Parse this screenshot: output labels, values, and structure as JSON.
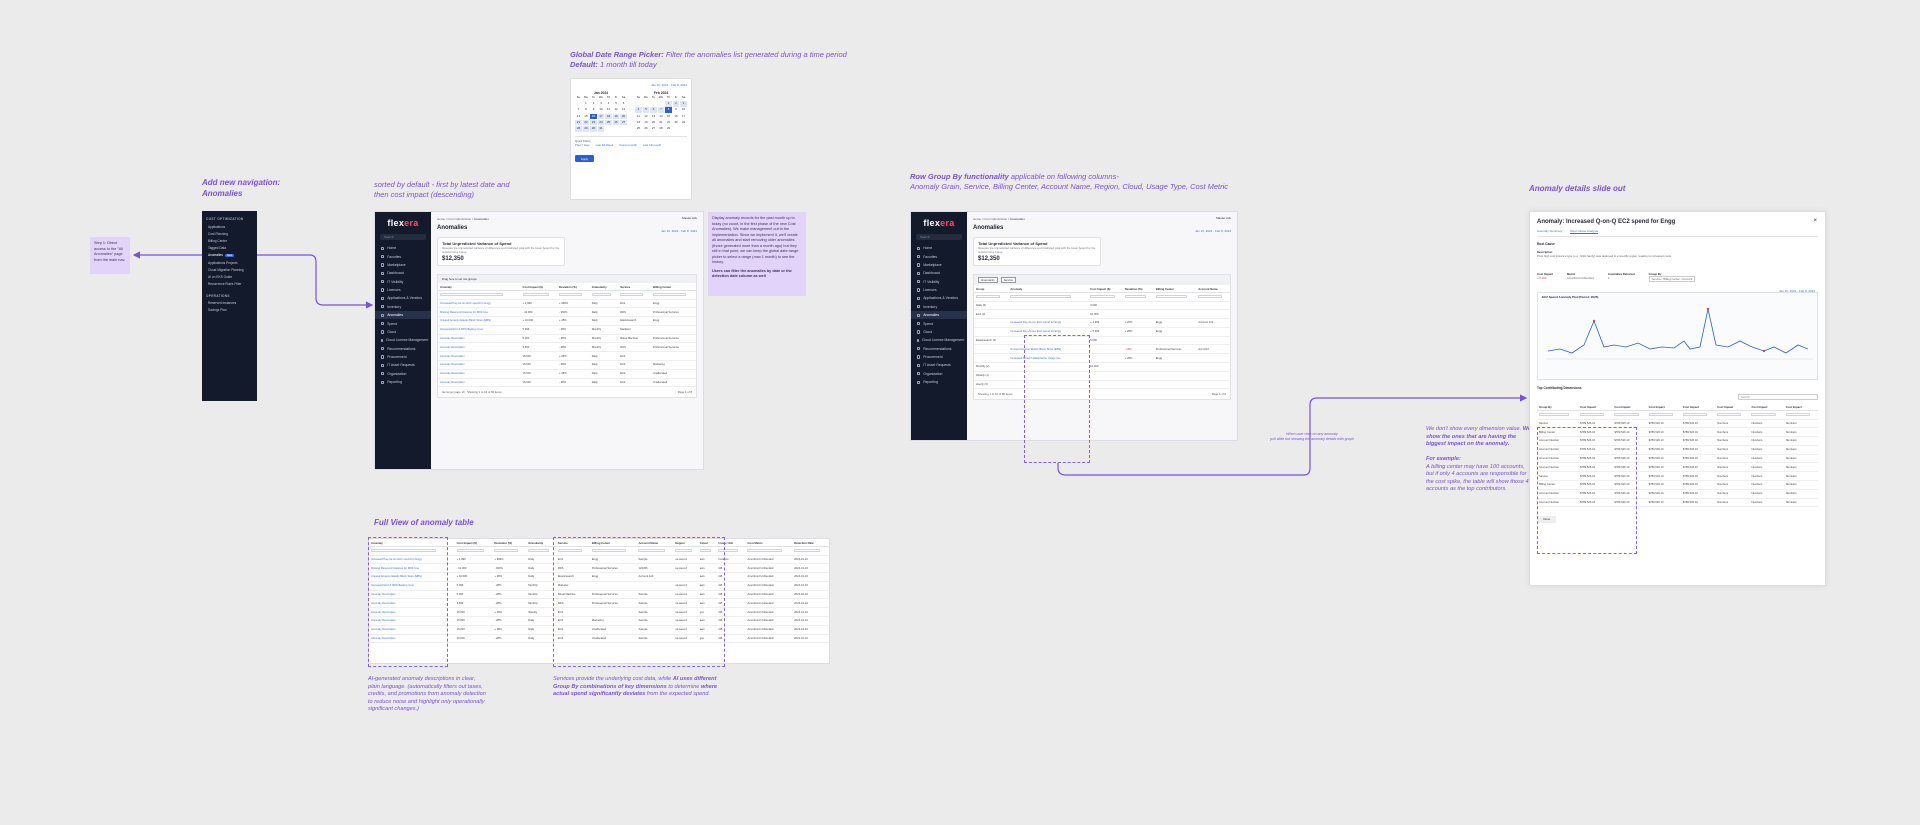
{
  "annotations": {
    "nav_title": "Add new navigation:",
    "nav_sub": "Anomalies",
    "sort_note": "sorted by default - first by latest date and then cost impact (descending)",
    "date_title": "Global Date Range Picker:",
    "date_desc": "Filter the anomalies list generated during a time period",
    "date_default_label": "Default:",
    "date_default_value": "1 month till today",
    "groupby_title": "Row Group By functionality",
    "groupby_desc": "applicable on following columns-",
    "groupby_cols": "Anomaly Grain, Service, Billing Center, Account Name, Region, Cloud, Usage Type, Cost Metric",
    "details_title": "Anomaly details slide out",
    "fullview_title": "Full View of anomaly table",
    "ai_note": "AI-generated anomaly descriptions in clear, plain language. (automatically filters out taxes, credits, and promotions from anomaly detection to reduce noise and highlight only operationally significant changes.)",
    "services_note_a": "Services provide the underlying cost data, while",
    "services_note_b": "AI uses different Group By combinations of key dimensions",
    "services_note_c": "to determine",
    "services_note_d": "where actual spend significantly deviates",
    "services_note_e": "from the expected spend.",
    "dim_note_a": "We don't show every dimension value.",
    "dim_note_b": "We show the ones that are having the biggest impact on the anomaly.",
    "dim_note_c": "For example:",
    "dim_note_d": "A billing center may have 100 accounts, but if only 4 accounts are responsible for the cost spike, the table will show those 4 accounts as the top contributors.",
    "click_note": "When user click on any anomaly",
    "click_note2": "pull slide out showing the anomaly details with graph",
    "step_note": "Step 1: Direct access to the \"All Anomalies\" page from the main nav.",
    "right_note": "Display anomaly records for the past month up to today (no count, in the first phase of the new Cost Anomalies). We make management out to the implementation. Since we implement it, we'll create all anomalies and start removing older anomalies (those generated more than a month ago) but they still in that point, we can keep the global date range picker to select a range (max 1 month) to see the history.",
    "right_note_b": "Users can filter the anomalies by date or the detection date column as well"
  },
  "mini_menu": {
    "header": "COST OPTIMIZATION",
    "items": [
      "Applications",
      "Cost Planning",
      "Billing Center",
      "Tagged Data",
      "Anomalies",
      "Applications Projects",
      "Cloud Migration Planning",
      "AI on EKS Guide",
      "Recurrence Rules Filter"
    ],
    "badge": "New",
    "header2": "OPERATIONS",
    "items2": [
      "Reserved Instances",
      "Savings Plan"
    ]
  },
  "app": {
    "logo_a": "flex",
    "logo_b": "era",
    "search": "Search",
    "nav": [
      "Home",
      "Favorites",
      "Marketplace",
      "Dashboard",
      "IT Visibility",
      "Licenses",
      "Applications & Vendors",
      "Inventory",
      "Anomalies",
      "Spend",
      "Cloud",
      "Cloud License Management",
      "Recommendations",
      "Procurement",
      "IT Asset Requests",
      "Organization",
      "Reporting"
    ],
    "crumb_a": "Home / Cost Optimization /",
    "crumb_b": "Anomalies",
    "org": "Master Ack",
    "title": "Anomalies",
    "date_range": "Jan 16, 2024 - Feb 8, 2024",
    "card_title": "Total Unpredicted Variance of Spend",
    "card_desc": "Measure the unpredicted variance of difference and predicted total with the lower bound for the selected time frame.",
    "card_value": "$12,350",
    "group_hint": "Drag here to set row groups",
    "columns": [
      "Anomaly",
      "Cost Impact ($)",
      "Deviation (%)",
      "Granularity",
      "Service",
      "Billing Center"
    ],
    "rows": [
      [
        "Increased Pay-As-Go EC2 spend for Engg",
        "+ 4,999",
        "+ 999%",
        "Daily",
        "EC2",
        "Engg"
      ],
      [
        "Missing Reserved instance for RDS Use",
        "- 12,000",
        "- 960%",
        "Daily",
        "RDS",
        "Professional Services"
      ],
      [
        "Unused Amazon Elastic Block Store (EBS)",
        "+ 10,000",
        "+ 28%",
        "Daily",
        "Elasticsearch",
        "Engg"
      ],
      [
        "Increased EC2 & RDS Backup Cost",
        "5,996",
        "- 28%",
        "Monthly",
        "Marketer",
        ""
      ],
      [
        "Anomaly Description",
        "5,000",
        "- 28%",
        "Monthly",
        "Ritual Machine",
        "Professional Services"
      ],
      [
        "Anomaly Description",
        "3,560",
        "- 28%",
        "Monthly",
        "RDS",
        "Professional Services"
      ],
      [
        "Anomaly Description",
        "15,000",
        "+ 28%",
        "Daily",
        "EC2",
        ""
      ],
      [
        "Anomaly Description",
        "15,000",
        "- 28%",
        "Daily",
        "EC2",
        "Marketing"
      ],
      [
        "Anomaly Description",
        "15,000",
        "+ 28%",
        "Daily",
        "EC2",
        "Unallocated"
      ],
      [
        "Anomaly Description",
        "15,000",
        "- 28%",
        "Daily",
        "EC2",
        "Unallocated"
      ]
    ],
    "rows_per_page": "Items per page",
    "rows_per_page_val": "10",
    "showing": "Showing 1 to 10 of 80 items",
    "page": "Page 1 of 8"
  },
  "calendar": {
    "range": "Jan 16, 2024 - Feb 8, 2024",
    "m1": "Jan 2024",
    "m2": "Feb 2024",
    "dow": [
      "Su",
      "Mo",
      "Tu",
      "We",
      "Th",
      "Fr",
      "Sa"
    ],
    "quick_title": "Quick Filters",
    "quick": [
      "Past 7 days",
      "Last full Week",
      "Current month",
      "Last full month"
    ],
    "apply": "Apply"
  },
  "group_app": {
    "date_range": "Jan 16, 2024 - Feb 8, 2024",
    "chips": [
      "Granularity",
      "Service"
    ],
    "columns": [
      "Group",
      "Anomaly",
      "Cost Impact ($)",
      "Deviation (%)",
      "Billing Center",
      "Account Name"
    ],
    "rows": [
      [
        "Daily (6)",
        "",
        "3,000",
        "",
        "",
        ""
      ],
      [
        "EC2 (3)",
        "",
        "10,000",
        "",
        "",
        ""
      ],
      [
        "",
        "Increased Pay-As-Go EC2 spend for Engg",
        "+ 4,999",
        "+ 20%",
        "Engg",
        "Account 123"
      ],
      [
        "",
        "Increased Pay-As-Go EC2 spend for Engg",
        "+ 5,999",
        "+ 28%",
        "Engg",
        ""
      ],
      [
        "Elasticsearch (2)",
        "",
        "5,000",
        "",
        "",
        ""
      ],
      [
        "",
        "Unused Amazon Elastic Block Store (EBS)",
        "",
        "- 28%",
        "Professional Services",
        "Acct-012"
      ],
      [
        "",
        "Increased Amazon Elasticache Usage (su...",
        "",
        "+ 28%",
        "Engg",
        ""
      ],
      [
        "Monthly (2)",
        "",
        "13,000",
        "",
        "",
        ""
      ],
      [
        "Weekly (1)",
        "",
        "",
        "",
        "",
        ""
      ],
      [
        "Hourly (3)",
        "",
        "",
        "",
        "",
        ""
      ]
    ],
    "showing": "Showing 1 to 10 of 80 items",
    "page": "Page 1 of 8"
  },
  "details": {
    "title": "Anomaly: Increased Q-on-Q EC2 spend for Engg",
    "tabs": [
      "Anomaly Summary",
      "Root Cause Analysis"
    ],
    "root_cause": "Root Cause",
    "desc_label": "Description",
    "desc": "Pivot high cost instance type (e.g., ESG family) was deployed in a specific region, leading to increased costs.",
    "meta_labels": [
      "Cost Impact",
      "Metric",
      "Anomalies Detected",
      "Group By"
    ],
    "meta_values": [
      "+ 5,000",
      "Amortized Unblended",
      "4",
      "Service / Billing Center / Account"
    ],
    "date_range": "Jan 16, 2024 - Feb 8, 2024",
    "chart_title": "EC2 Spend Anomaly Plot (Period: 2025)",
    "top_contrib": "Top Contributing Dimensions",
    "search": "Search",
    "columns": [
      "Group By",
      "Cost Impact",
      "Cost Impact",
      "Cost Impact",
      "Cost Impact",
      "Cost Impact",
      "Cost Impact",
      "Cost Impact"
    ],
    "rows": [
      [
        "Service",
        "$789,526.10",
        "$789,526.10",
        "$789,526.10",
        "$789,526.10",
        "Numbers",
        "Numbers",
        "Numbers"
      ],
      [
        "Billing Center",
        "$789,526.10",
        "$789,526.10",
        "$789,526.10",
        "$789,526.10",
        "Numbers",
        "Numbers",
        "Numbers"
      ],
      [
        "Account Number",
        "$789,526.10",
        "$789,526.10",
        "$789,526.10",
        "$789,526.10",
        "Numbers",
        "Numbers",
        "Numbers"
      ],
      [
        "Account Number",
        "$789,526.10",
        "$789,526.10",
        "$789,526.10",
        "$789,526.10",
        "Numbers",
        "Numbers",
        "Numbers"
      ],
      [
        "Account Number",
        "$789,526.10",
        "$789,526.10",
        "$789,526.10",
        "$789,526.10",
        "Numbers",
        "Numbers",
        "Numbers"
      ],
      [
        "Account Number",
        "$789,526.10",
        "$789,526.10",
        "$789,526.10",
        "$789,526.10",
        "Numbers",
        "Numbers",
        "Numbers"
      ],
      [
        "Service",
        "$789,526.10",
        "$789,526.10",
        "$789,526.10",
        "$789,526.10",
        "Numbers",
        "Numbers",
        "Numbers"
      ],
      [
        "Billing Center",
        "$789,526.10",
        "$789,526.10",
        "$789,526.10",
        "$789,526.10",
        "Numbers",
        "Numbers",
        "Numbers"
      ],
      [
        "Account Number",
        "$789,526.10",
        "$789,526.10",
        "$789,526.10",
        "$789,526.10",
        "Numbers",
        "Numbers",
        "Numbers"
      ],
      [
        "Account Number",
        "$789,526.10",
        "$789,526.10",
        "$789,526.10",
        "$789,526.10",
        "Numbers",
        "Numbers",
        "Numbers"
      ]
    ],
    "close": "Close"
  },
  "full_table": {
    "columns": [
      "Anomaly",
      "Cost Impact ($)",
      "Deviation (%)",
      "Granularity",
      "Service",
      "Billing Center",
      "Account Name",
      "Region",
      "Cloud",
      "Usage Unit",
      "Cost Metric",
      "Detection Date"
    ],
    "rows": [
      [
        "Increased Pay-As-Go EC2 spend for Engg",
        "+ 4,999",
        "+ 999%",
        "Daily",
        "EC2",
        "Engg",
        "Sample",
        "us-west-2",
        "aws",
        "Instance",
        "Amortized Unblended",
        "2024-01-16"
      ],
      [
        "Missing Reserved instance for RDS Use",
        "- 12,000",
        "- 960%",
        "Daily",
        "RDS",
        "Professional Services",
        "123456",
        "us-west-2",
        "aws",
        "GB",
        "Amortized Unblended",
        "2024-01-16"
      ],
      [
        "Unused Amazon Elastic Block Store (EBS)",
        "+ 10,000",
        "+ 28%",
        "Daily",
        "Elasticsearch",
        "Engg",
        "Account 123",
        "",
        "aws",
        "GB",
        "Amortized Unblended",
        "2024-01-16"
      ],
      [
        "Increased EC2 & RDS Backup Cost",
        "5,996",
        "- 28%",
        "Monthly",
        "Marketer",
        "",
        "",
        "us-west-2",
        "aws",
        "GB",
        "Amortized Unblended",
        "2024-01-16"
      ],
      [
        "Anomaly Description",
        "5,000",
        "- 28%",
        "Monthly",
        "Ritual Machine",
        "Professional Services",
        "Sample",
        "us-west-2",
        "aws",
        "GB",
        "Amortized Unblended",
        "2024-01-16"
      ],
      [
        "Anomaly Description",
        "3,560",
        "- 28%",
        "Monthly",
        "RDS",
        "Professional Services",
        "Sample",
        "us-west-2",
        "aws",
        "GB",
        "Amortized Unblended",
        "2024-01-16"
      ],
      [
        "Anomaly Description",
        "15,000",
        "+ 28%",
        "Weekly",
        "EC2",
        "",
        "Sample",
        "us-west-2",
        "gcp",
        "GB",
        "Amortized Unblended",
        "2024-01-16"
      ],
      [
        "Anomaly Description",
        "15,000",
        "- 28%",
        "Daily",
        "EC2",
        "Marketing",
        "Sample",
        "us-west-2",
        "aws",
        "GB",
        "Amortized Unblended",
        "2024-01-16"
      ],
      [
        "Anomaly Description",
        "15,000",
        "+ 28%",
        "Daily",
        "EC2",
        "Unallocated",
        "Sample",
        "us-west-2",
        "aws",
        "GB",
        "Amortized Unblended",
        "2024-01-16"
      ],
      [
        "Anomaly Description",
        "15,000",
        "- 28%",
        "Daily",
        "EC2",
        "Unallocated",
        "Sample",
        "us-west-2",
        "gcp",
        "GB",
        "Amortized Unblended",
        "2024-01-16"
      ]
    ]
  }
}
